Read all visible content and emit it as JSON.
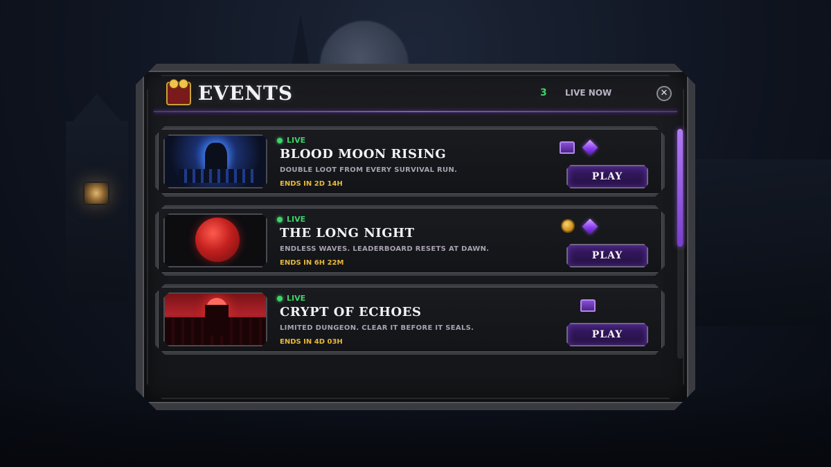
{
  "header": {
    "title": "EVENTS",
    "live_count": "3",
    "live_label": "LIVE NOW",
    "close_label": "✕"
  },
  "colors": {
    "accent": "#8a4ee0",
    "live_green": "#3ed36a",
    "timer_gold": "#e7b93a"
  },
  "events": [
    {
      "status": "LIVE",
      "title": "BLOOD MOON RISING",
      "description": "DOUBLE LOOT FROM EVERY SURVIVAL RUN.",
      "ends": "ENDS IN 2D 14H",
      "rewards": [
        "chest-icon",
        "gem-icon"
      ],
      "play_label": "PLAY"
    },
    {
      "status": "LIVE",
      "title": "THE LONG NIGHT",
      "description": "ENDLESS WAVES. LEADERBOARD RESETS AT DAWN.",
      "ends": "ENDS IN 6H 22M",
      "rewards": [
        "coin-icon",
        "gem-icon"
      ],
      "play_label": "PLAY"
    },
    {
      "status": "LIVE",
      "title": "CRYPT OF ECHOES",
      "description": "LIMITED DUNGEON. CLEAR IT BEFORE IT SEALS.",
      "ends": "ENDS IN 4D 03H",
      "rewards": [
        "chest-icon"
      ],
      "play_label": "PLAY"
    }
  ]
}
